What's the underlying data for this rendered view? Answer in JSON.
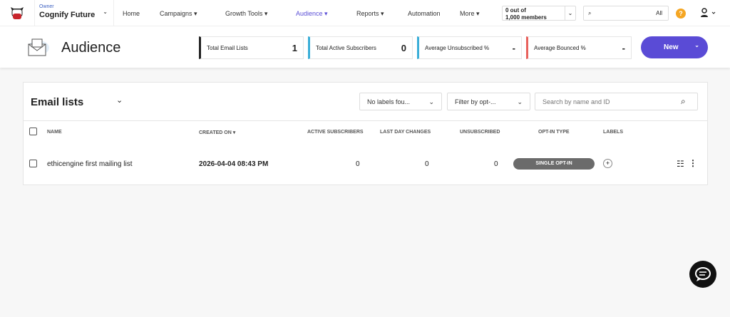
{
  "account": {
    "role": "Owner",
    "name": "Cognify Future"
  },
  "nav": [
    {
      "label": "Home"
    },
    {
      "label": "Campaigns ▾"
    },
    {
      "label": "Growth Tools ▾"
    },
    {
      "label": "Audience ▾"
    },
    {
      "label": "Reports ▾"
    },
    {
      "label": "Automation"
    },
    {
      "label": "More ▾"
    }
  ],
  "members": {
    "line1": "0 out of",
    "line2": "1,000 members"
  },
  "search": {
    "scope": "All"
  },
  "page": {
    "title": "Audience"
  },
  "stats": [
    {
      "label": "Total Email Lists",
      "value": "1",
      "color": "#222222"
    },
    {
      "label": "Total Active Subscribers",
      "value": "0",
      "color": "#3aaed8"
    },
    {
      "label": "Average Unsubscribed %",
      "value": "-",
      "color": "#3aaed8"
    },
    {
      "label": "Average Bounced %",
      "value": "-",
      "color": "#e8615c"
    }
  ],
  "new_button": "New",
  "lists": {
    "title": "Email lists",
    "labels_filter": "No labels fou...",
    "optin_filter": "Filter by opt-...",
    "search_placeholder": "Search by name and ID",
    "columns": [
      "NAME",
      "CREATED ON ▾",
      "ACTIVE SUBSCRIBERS",
      "LAST DAY CHANGES",
      "UNSUBSCRIBED",
      "OPT-IN TYPE",
      "LABELS"
    ],
    "rows": [
      {
        "name": "ethicengine first mailing list",
        "created": "2026-04-04 08:43 PM",
        "active": "0",
        "changes": "0",
        "unsub": "0",
        "optin": "SINGLE OPT-IN"
      }
    ]
  }
}
